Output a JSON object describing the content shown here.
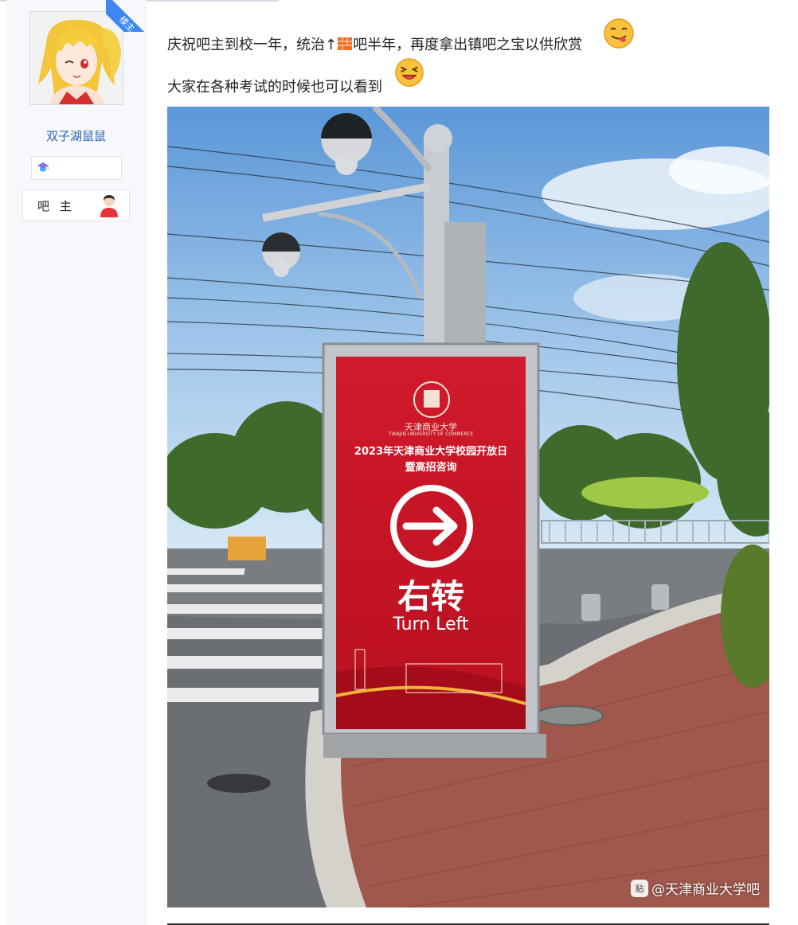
{
  "profile": {
    "username": "双子湖鼠鼠",
    "ribbon_label": "楼主",
    "role_label": "吧 主"
  },
  "post": {
    "line1_before": "庆祝吧主到校一年，统治↑",
    "line1_after": "吧半年，再度拿出镇吧之宝以供欣赏",
    "line2": "大家在各种考试的时候也可以看到"
  },
  "photo": {
    "sign_school_script": "天津商业大学",
    "sign_school_en": "TIANJIN UNIVERSITY OF COMMERCE",
    "sign_title_1": "2023年天津商业大学校园开放日",
    "sign_title_2": "暨高招咨询",
    "sign_direction_cn": "右转",
    "sign_direction_en": "Turn Left",
    "watermark": "@天津商业大学吧",
    "watermark_badge": "贴"
  },
  "colors": {
    "accent": "#3d87f5",
    "username": "#2d64b3",
    "sign_red": "#c8162a"
  }
}
